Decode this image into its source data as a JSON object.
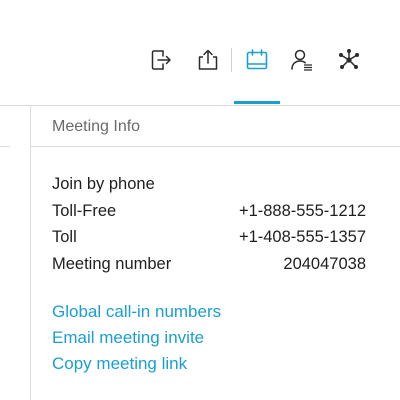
{
  "colors": {
    "accent": "#1a9fd0",
    "icon": "#2b2b2b",
    "link": "#1a9fd0"
  },
  "toolbar": {
    "buttons": [
      {
        "icon": "leave-icon"
      },
      {
        "icon": "share-icon"
      },
      {
        "icon": "meeting-info-icon",
        "active": true
      },
      {
        "icon": "participants-icon"
      },
      {
        "icon": "more-icon"
      }
    ]
  },
  "panel": {
    "title": "Meeting Info",
    "join_heading": "Join by phone",
    "rows": [
      {
        "label": "Toll-Free",
        "value": "+1-888-555-1212"
      },
      {
        "label": "Toll",
        "value": "+1-408-555-1357"
      },
      {
        "label": "Meeting number",
        "value": "204047038"
      }
    ],
    "links": [
      "Global call-in numbers",
      "Email meeting invite",
      "Copy meeting link"
    ]
  }
}
